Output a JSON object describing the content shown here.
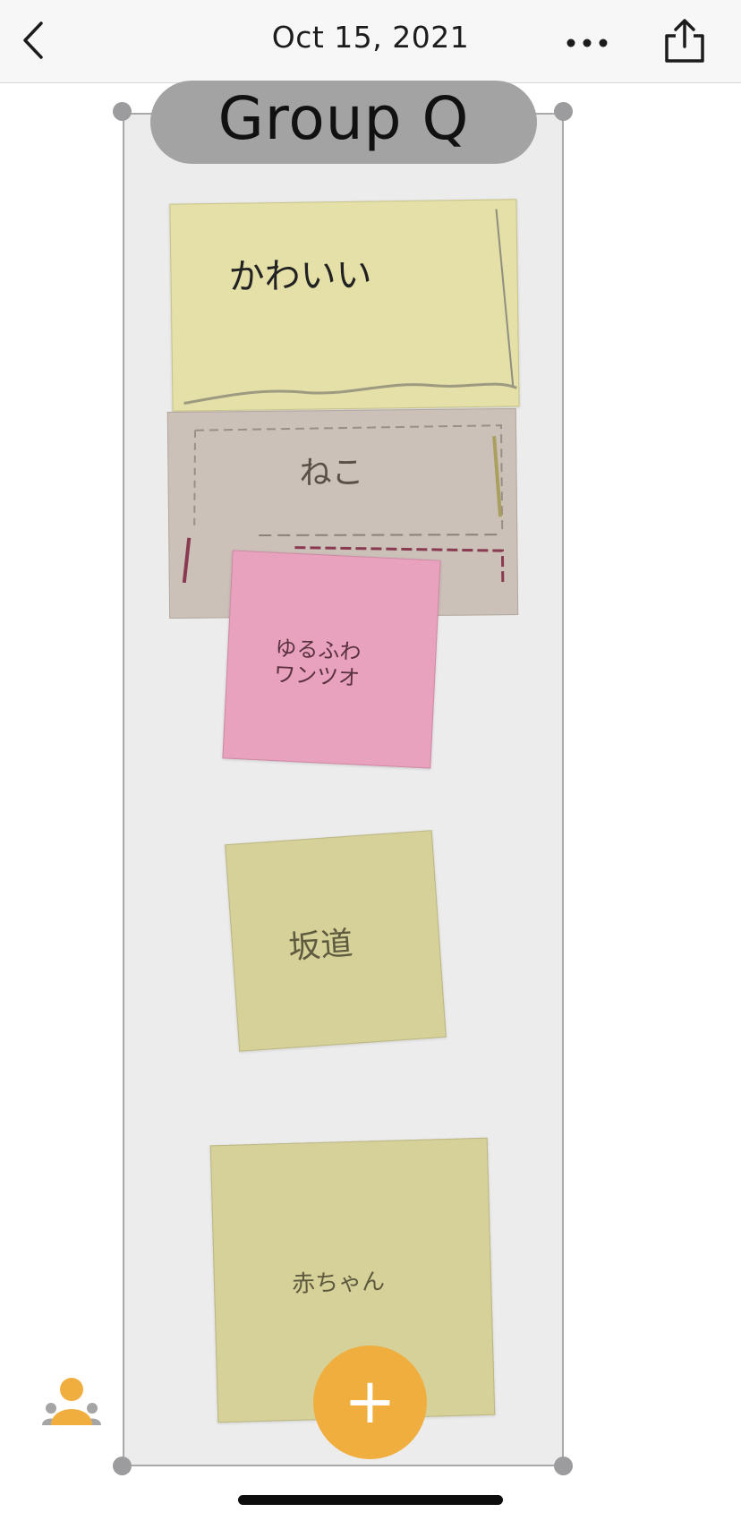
{
  "header": {
    "date": "Oct 15, 2021",
    "back_icon": "chevron-left-icon",
    "more_icon": "ellipsis-icon",
    "share_icon": "share-icon"
  },
  "group": {
    "name": "Group Q"
  },
  "notes": [
    {
      "text": "かわいい",
      "color": "#e4e0a8"
    },
    {
      "text": "ねこ",
      "color": "#cbc1b9"
    },
    {
      "text": "ゆるふわ\nワンツオ",
      "color": "#e9a2bd"
    },
    {
      "text": "坂道",
      "color": "#d6d198"
    },
    {
      "text": "赤ちゃん",
      "color": "#d6d198"
    }
  ],
  "fab": {
    "label": "+",
    "color": "#f0ae3f"
  },
  "people_icon": "people-icon",
  "accent_color": "#f0ae3f"
}
